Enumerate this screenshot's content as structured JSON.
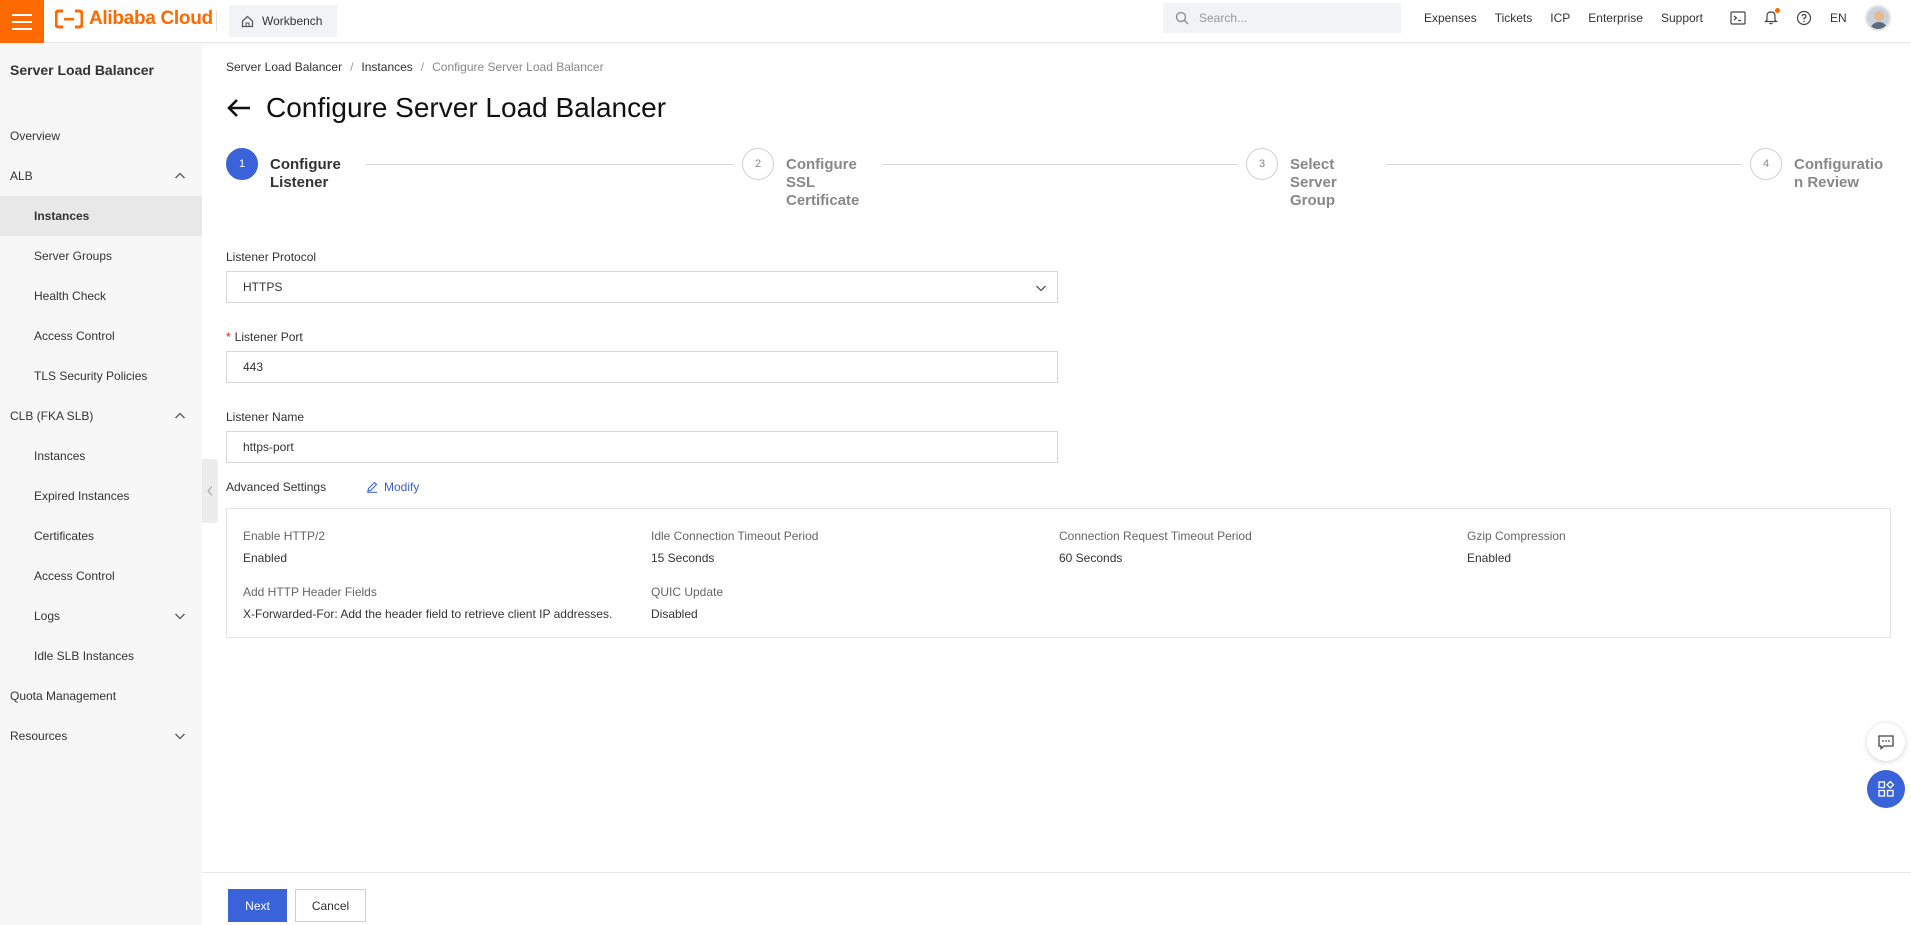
{
  "topbar": {
    "logo_text": "Alibaba Cloud",
    "workbench_label": "Workbench",
    "search_placeholder": "Search...",
    "links": [
      "Expenses",
      "Tickets",
      "ICP",
      "Enterprise",
      "Support"
    ],
    "language": "EN",
    "brand_color": "#ff6a00"
  },
  "sidebar": {
    "title": "Server Load Balancer",
    "items": [
      {
        "label": "Overview",
        "level": 1
      },
      {
        "label": "ALB",
        "level": 1,
        "chevron": "up"
      },
      {
        "label": "Instances",
        "level": 2,
        "active": true
      },
      {
        "label": "Server Groups",
        "level": 2
      },
      {
        "label": "Health Check",
        "level": 2
      },
      {
        "label": "Access Control",
        "level": 2
      },
      {
        "label": "TLS Security Policies",
        "level": 2
      },
      {
        "label": "CLB (FKA SLB)",
        "level": 1,
        "chevron": "up"
      },
      {
        "label": "Instances",
        "level": 2
      },
      {
        "label": "Expired Instances",
        "level": 2
      },
      {
        "label": "Certificates",
        "level": 2
      },
      {
        "label": "Access Control",
        "level": 2
      },
      {
        "label": "Logs",
        "level": 2,
        "chevron": "down"
      },
      {
        "label": "Idle SLB Instances",
        "level": 2
      },
      {
        "label": "Quota Management",
        "level": 1
      },
      {
        "label": "Resources",
        "level": 1,
        "chevron": "down"
      }
    ]
  },
  "breadcrumb": {
    "items": [
      "Server Load Balancer",
      "Instances",
      "Configure Server Load Balancer"
    ]
  },
  "page_title": "Configure Server Load Balancer",
  "steps": [
    {
      "number": "1",
      "label_lines": [
        "Configure",
        "Listener"
      ],
      "active": true
    },
    {
      "number": "2",
      "label_lines": [
        "Configure",
        "SSL",
        "Certificate"
      ],
      "active": false
    },
    {
      "number": "3",
      "label_lines": [
        "Select",
        "Server",
        "Group"
      ],
      "active": false
    },
    {
      "number": "4",
      "label_lines": [
        "Configuratio",
        "n Review"
      ],
      "active": false
    }
  ],
  "form": {
    "protocol_label": "Listener Protocol",
    "protocol_value": "HTTPS",
    "port_label": "Listener Port",
    "port_required": "*",
    "port_value": "443",
    "name_label": "Listener Name",
    "name_value": "https-port"
  },
  "advanced": {
    "label": "Advanced Settings",
    "modify_label": "Modify",
    "fields": [
      {
        "key": "Enable HTTP/2",
        "value": "Enabled"
      },
      {
        "key": "Idle Connection Timeout Period",
        "value": "15 Seconds"
      },
      {
        "key": "Connection Request Timeout Period",
        "value": "60 Seconds"
      },
      {
        "key": "Gzip Compression",
        "value": "Enabled"
      },
      {
        "key": "Add HTTP Header Fields",
        "value": "X-Forwarded-For: Add the header field to retrieve client IP addresses."
      },
      {
        "key": "QUIC Update",
        "value": "Disabled"
      }
    ]
  },
  "footer": {
    "next_label": "Next",
    "cancel_label": "Cancel"
  },
  "accent_color": "#3a63d9"
}
